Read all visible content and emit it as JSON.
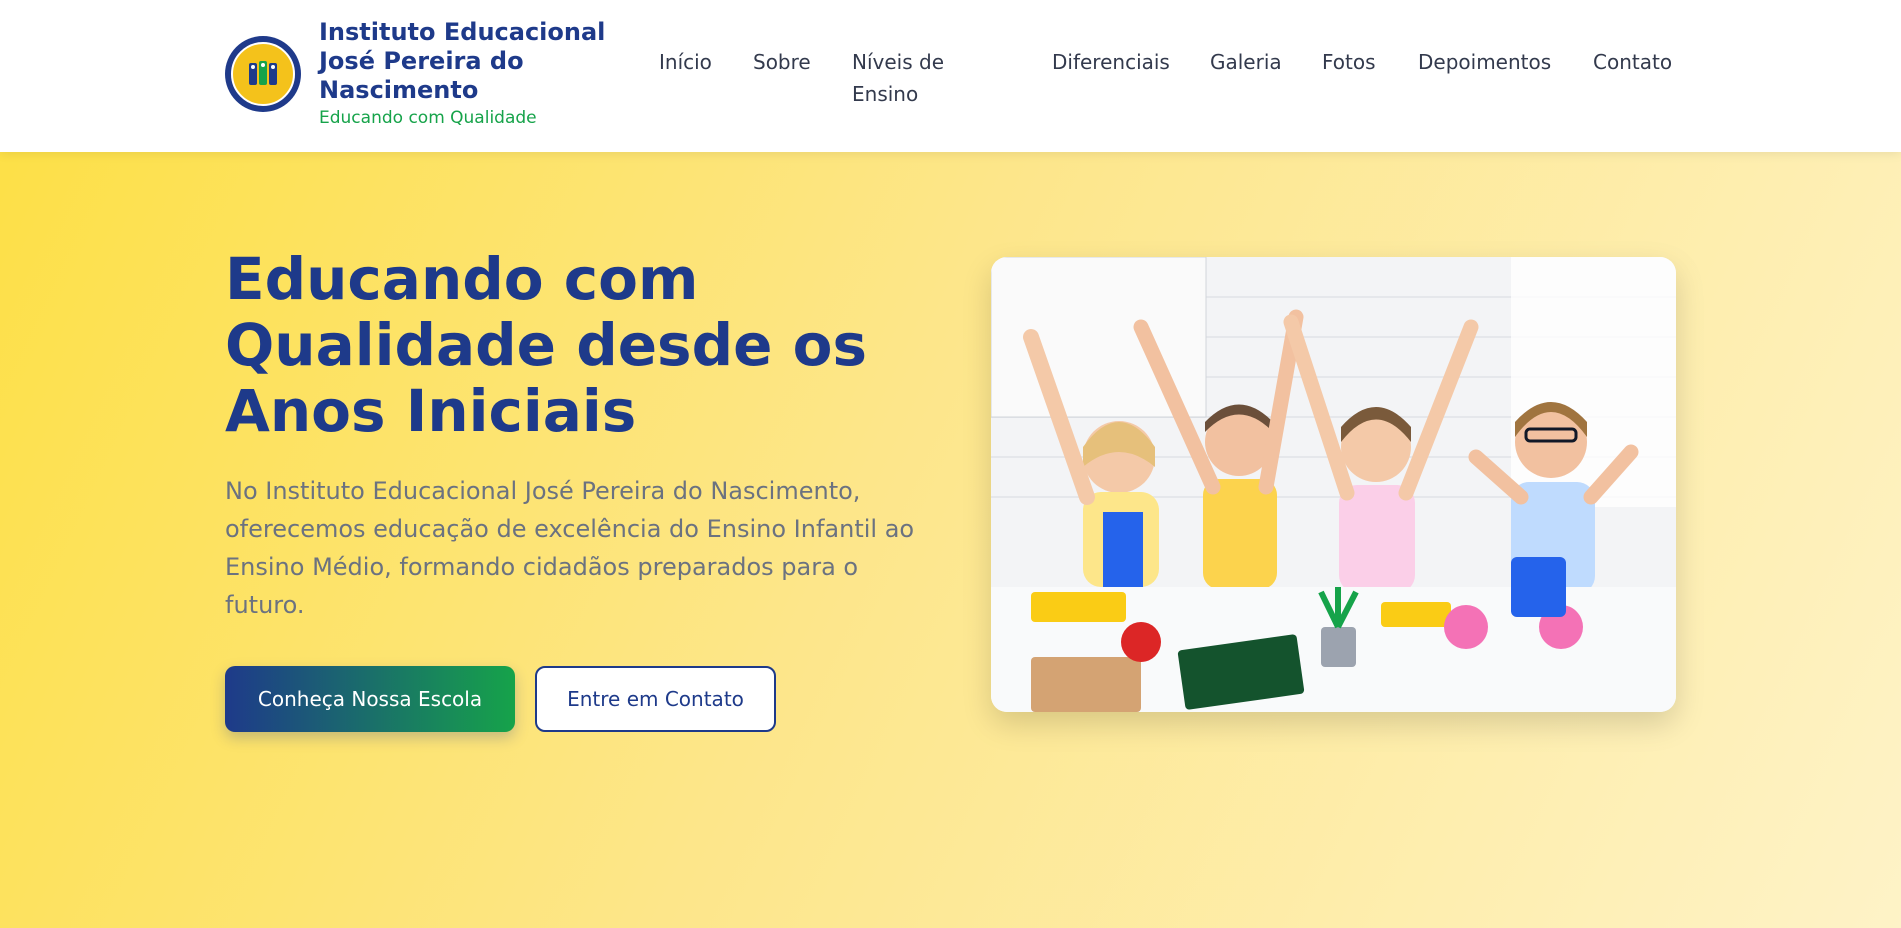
{
  "brand": {
    "name": "Instituto Educacional José Pereira do Nascimento",
    "tagline": "Educando com Qualidade"
  },
  "nav": {
    "items": [
      {
        "label": "Início"
      },
      {
        "label": "Sobre"
      },
      {
        "label": "Níveis de Ensino"
      },
      {
        "label": "Diferenciais"
      },
      {
        "label": "Galeria"
      },
      {
        "label": "Fotos"
      },
      {
        "label": "Depoimentos"
      },
      {
        "label": "Contato"
      }
    ]
  },
  "hero": {
    "title": "Educando com Qualidade desde os Anos Iniciais",
    "description": "No Instituto Educacional José Pereira do Nascimento, oferecemos educação de excelência do Ensino Infantil ao Ensino Médio, formando cidadãos preparados para o futuro.",
    "primary_button": "Conheça Nossa Escola",
    "secondary_button": "Entre em Contato"
  },
  "colors": {
    "brand_blue": "#1e3a8a",
    "brand_green": "#16a34a",
    "hero_yellow": "#fde047"
  }
}
